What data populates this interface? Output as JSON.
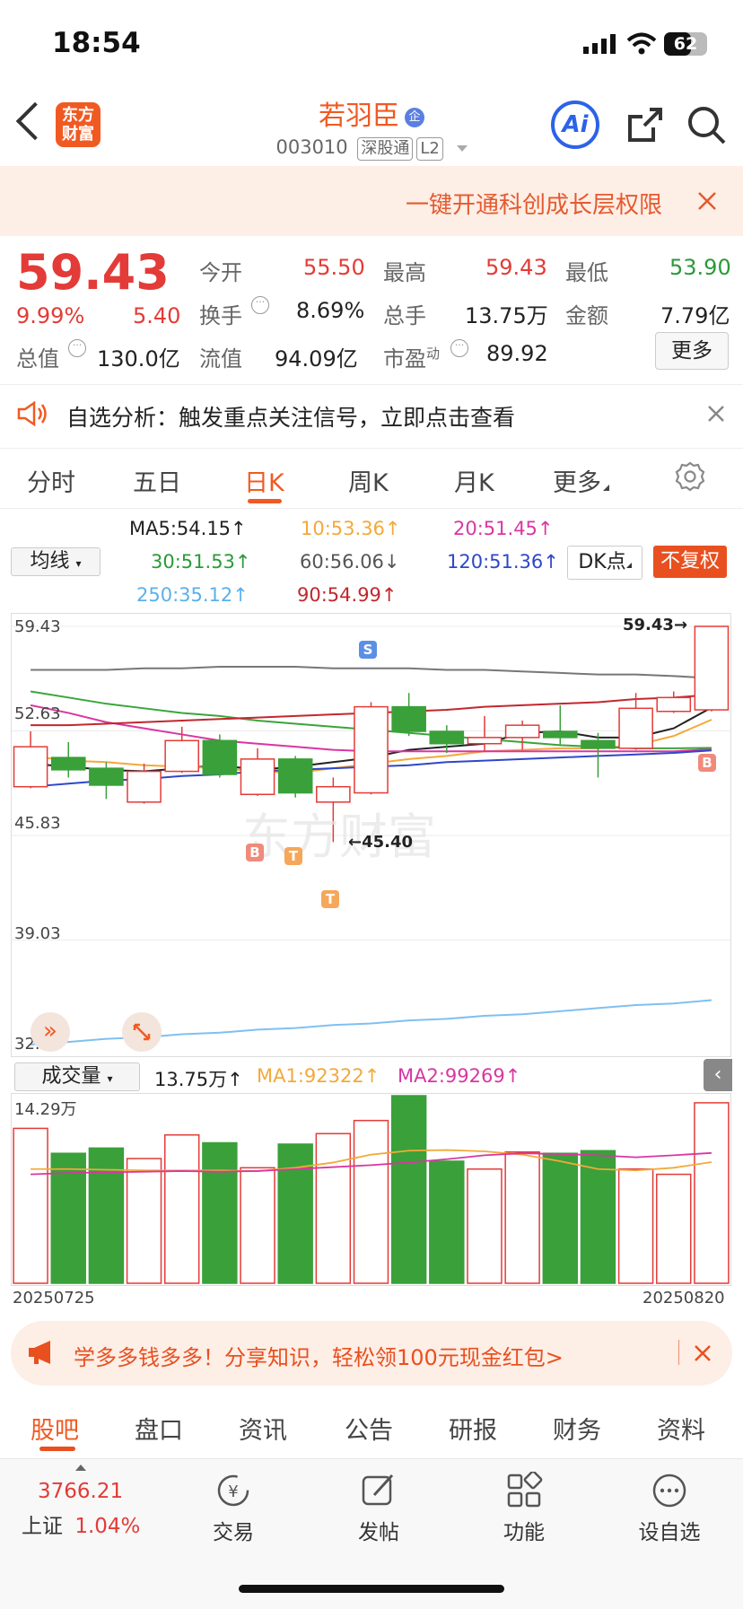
{
  "status_bar": {
    "time": "18:54",
    "battery": "62"
  },
  "header": {
    "logo_line1": "东方",
    "logo_line2": "财富",
    "stock_name": "若羽臣",
    "badge": "企",
    "code": "003010",
    "exchange_tag": "深股通",
    "level_tag": "L2",
    "ai_label": "Ai"
  },
  "banner": {
    "text": "一键开通科创成长层权限"
  },
  "quote": {
    "price": "59.43",
    "change_pct": "9.99%",
    "change": "5.40",
    "open_label": "今开",
    "open": "55.50",
    "high_label": "最高",
    "high": "59.43",
    "low_label": "最低",
    "low": "53.90",
    "turnover_label": "换手",
    "turnover": "8.69%",
    "volume_label": "总手",
    "volume": "13.75万",
    "amount_label": "金额",
    "amount": "7.79亿",
    "mktcap_label": "总值",
    "mktcap": "130.0亿",
    "float_label": "流值",
    "float": "94.09亿",
    "pe_label": "市盈",
    "pe_sup": "动",
    "pe": "89.92",
    "more_label": "更多"
  },
  "notice": {
    "text": "自选分析：触发重点关注信号，立即点击查看"
  },
  "chart_tabs": [
    {
      "label": "分时"
    },
    {
      "label": "五日"
    },
    {
      "label": "日K"
    },
    {
      "label": "周K"
    },
    {
      "label": "月K"
    },
    {
      "label": "更多"
    }
  ],
  "ma_indicators": {
    "select_label": "均线",
    "ma5": "MA5:54.15↑",
    "ma10": "10:53.36↑",
    "ma20": "20:51.45↑",
    "ma30": "30:51.53↑",
    "ma60": "60:56.06↓",
    "ma120": "120:51.36↑",
    "ma250": "250:35.12↑",
    "ma90": "90:54.99↑",
    "dk_label": "DK点",
    "fq_label": "不复权"
  },
  "price_axis": {
    "labels": [
      "59.43",
      "52.63",
      "45.83",
      "39.03",
      "32.23"
    ],
    "high_marker": "59.43",
    "low_marker": "45.40",
    "watermark": "东方财富",
    "marker_S": "S",
    "marker_B": "B",
    "marker_T": "T"
  },
  "volume_bar": {
    "select_label": "成交量",
    "volume": "13.75万↑",
    "ma1": "MA1:92322↑",
    "ma2": "MA2:99269↑",
    "axis_max": "14.29万",
    "date_start": "20250725",
    "date_end": "20250820"
  },
  "chart_data": {
    "type": "candlestick",
    "ylim": [
      32.23,
      59.43
    ],
    "candles": [
      {
        "o": 49.0,
        "c": 51.6,
        "h": 52.6,
        "l": 48.9,
        "up": true
      },
      {
        "o": 50.9,
        "c": 50.1,
        "h": 51.9,
        "l": 49.6,
        "up": false
      },
      {
        "o": 50.2,
        "c": 49.1,
        "h": 50.6,
        "l": 48.2,
        "up": false
      },
      {
        "o": 48.0,
        "c": 50.0,
        "h": 50.5,
        "l": 47.9,
        "up": true
      },
      {
        "o": 50.0,
        "c": 52.0,
        "h": 52.9,
        "l": 49.9,
        "up": true
      },
      {
        "o": 52.0,
        "c": 49.8,
        "h": 52.4,
        "l": 49.6,
        "up": false
      },
      {
        "o": 48.5,
        "c": 50.8,
        "h": 51.5,
        "l": 48.4,
        "up": true
      },
      {
        "o": 50.8,
        "c": 48.6,
        "h": 51.0,
        "l": 48.3,
        "up": false
      },
      {
        "o": 48.0,
        "c": 49.0,
        "h": 49.6,
        "l": 45.4,
        "up": true
      },
      {
        "o": 48.6,
        "c": 54.2,
        "h": 54.5,
        "l": 48.5,
        "up": true
      },
      {
        "o": 54.2,
        "c": 52.6,
        "h": 55.1,
        "l": 52.3,
        "up": false
      },
      {
        "o": 52.6,
        "c": 51.8,
        "h": 53.0,
        "l": 51.2,
        "up": false
      },
      {
        "o": 51.8,
        "c": 52.2,
        "h": 53.6,
        "l": 51.3,
        "up": true
      },
      {
        "o": 52.2,
        "c": 53.0,
        "h": 53.3,
        "l": 51.4,
        "up": true
      },
      {
        "o": 52.6,
        "c": 52.2,
        "h": 54.3,
        "l": 51.7,
        "up": false
      },
      {
        "o": 52.0,
        "c": 51.5,
        "h": 52.5,
        "l": 49.6,
        "up": false
      },
      {
        "o": 51.5,
        "c": 54.1,
        "h": 55.1,
        "l": 51.4,
        "up": true
      },
      {
        "o": 53.9,
        "c": 54.8,
        "h": 55.2,
        "l": 53.8,
        "up": true
      },
      {
        "o": 54.0,
        "c": 59.43,
        "h": 59.43,
        "l": 53.9,
        "up": true
      }
    ],
    "ma_series": [
      {
        "name": "MA5",
        "color": "#222222",
        "values": [
          50.5,
          50.3,
          50.1,
          50.0,
          50.2,
          50.4,
          50.1,
          50.3,
          50.6,
          50.9,
          51.4,
          51.6,
          51.8,
          52.5,
          52.6,
          52.2,
          52.2,
          52.8,
          54.15
        ]
      },
      {
        "name": "10",
        "color": "#f3a93a",
        "values": [
          51.0,
          50.7,
          50.6,
          50.4,
          50.3,
          50.2,
          50.0,
          49.9,
          50.2,
          50.5,
          50.8,
          51.0,
          51.3,
          51.4,
          51.5,
          51.5,
          51.7,
          52.3,
          53.36
        ]
      },
      {
        "name": "20",
        "color": "#d936a2",
        "values": [
          54.3,
          53.8,
          53.2,
          52.8,
          52.4,
          52.0,
          51.8,
          51.6,
          51.4,
          51.3,
          51.3,
          51.3,
          51.3,
          51.3,
          51.3,
          51.3,
          51.3,
          51.3,
          51.45
        ]
      },
      {
        "name": "30",
        "color": "#3aa53a",
        "values": [
          55.2,
          54.8,
          54.4,
          54.1,
          53.8,
          53.6,
          53.3,
          53.1,
          52.9,
          52.7,
          52.5,
          52.3,
          52.1,
          51.9,
          51.7,
          51.6,
          51.5,
          51.5,
          51.53
        ]
      },
      {
        "name": "60",
        "color": "#777777",
        "values": [
          56.6,
          56.6,
          56.6,
          56.7,
          56.7,
          56.8,
          56.8,
          56.8,
          56.7,
          56.7,
          56.7,
          56.6,
          56.6,
          56.5,
          56.4,
          56.3,
          56.3,
          56.2,
          56.06
        ]
      },
      {
        "name": "90",
        "color": "#c0282e",
        "values": [
          53.0,
          53.0,
          53.1,
          53.2,
          53.3,
          53.4,
          53.5,
          53.6,
          53.7,
          53.8,
          53.9,
          54.0,
          54.2,
          54.3,
          54.4,
          54.5,
          54.7,
          54.8,
          54.99
        ]
      },
      {
        "name": "120",
        "color": "#2f47c8",
        "values": [
          49.0,
          49.2,
          49.4,
          49.5,
          49.7,
          49.8,
          50.0,
          50.1,
          50.2,
          50.3,
          50.4,
          50.6,
          50.7,
          50.8,
          50.9,
          51.0,
          51.1,
          51.2,
          51.36
        ]
      },
      {
        "name": "250",
        "color": "#7fc0f0",
        "values": [
          32.23,
          32.4,
          32.6,
          32.7,
          32.9,
          33.0,
          33.2,
          33.3,
          33.5,
          33.6,
          33.8,
          33.9,
          34.1,
          34.2,
          34.4,
          34.6,
          34.8,
          34.9,
          35.12
        ]
      }
    ],
    "volume": {
      "ylim": [
        0,
        142900
      ],
      "values": [
        118000,
        99000,
        103000,
        95000,
        113000,
        107000,
        88000,
        106000,
        114000,
        124000,
        142900,
        93000,
        87000,
        100000,
        99000,
        101000,
        87000,
        83000,
        137500
      ],
      "up": [
        true,
        false,
        false,
        true,
        true,
        false,
        true,
        false,
        true,
        true,
        false,
        false,
        true,
        true,
        false,
        false,
        true,
        true,
        true
      ],
      "ma1": [
        87000,
        87000,
        86500,
        86000,
        86000,
        86000,
        85500,
        88000,
        92000,
        98000,
        101000,
        101500,
        100500,
        98000,
        93000,
        87000,
        86000,
        88000,
        92322
      ],
      "ma2": [
        83000,
        84000,
        84500,
        85000,
        85500,
        85000,
        85500,
        87000,
        88500,
        90000,
        92000,
        94500,
        97500,
        99000,
        98500,
        97500,
        96000,
        97500,
        99269
      ]
    }
  },
  "promo": {
    "text": "学多多钱多多！分享知识，轻松领100元现金红包>"
  },
  "bottom_tabs": [
    {
      "label": "股吧"
    },
    {
      "label": "盘口"
    },
    {
      "label": "资讯"
    },
    {
      "label": "公告"
    },
    {
      "label": "研报"
    },
    {
      "label": "财务"
    },
    {
      "label": "资料"
    }
  ],
  "index": {
    "value": "3766.21",
    "name": "上证",
    "change": "1.04%"
  },
  "nav": [
    {
      "label": "交易"
    },
    {
      "label": "发帖"
    },
    {
      "label": "功能"
    },
    {
      "label": "设自选"
    }
  ]
}
